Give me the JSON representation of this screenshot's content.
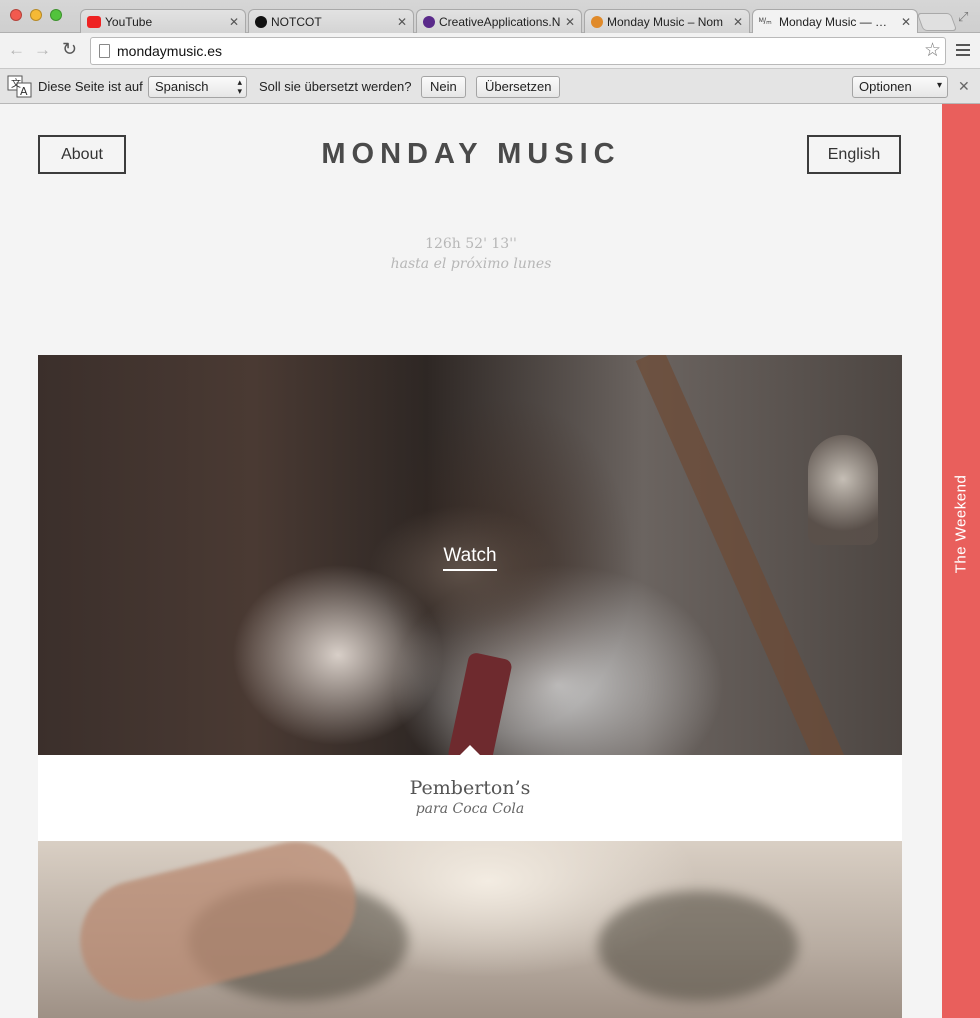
{
  "browser": {
    "tabs": [
      {
        "label": "YouTube",
        "icon": "youtube-icon",
        "active": false
      },
      {
        "label": "NOTCOT",
        "icon": "notcot-icon",
        "active": false
      },
      {
        "label": "CreativeApplications.N",
        "icon": "creativeapplications-icon",
        "active": false
      },
      {
        "label": "Monday Music – Nom",
        "icon": "monday-music-fav-icon",
        "active": false
      },
      {
        "label": "Monday Music — Mon",
        "icon": "mm-icon",
        "active": true
      }
    ],
    "url": "mondaymusic.es"
  },
  "translate_bar": {
    "prefix": "Diese Seite ist auf",
    "language": "Spanisch",
    "question": "Soll sie übersetzt werden?",
    "no_label": "Nein",
    "translate_label": "Übersetzen",
    "options_label": "Optionen"
  },
  "site": {
    "about_label": "About",
    "logo": "MONDAY MUSIC",
    "language_label": "English",
    "countdown": "126h 52' 13''",
    "countdown_sub": "hasta el próximo lunes",
    "side_tab_label": "The Weekend",
    "side_tab_color": "#e95f5c",
    "feature": {
      "watch_label": "Watch",
      "title": "Pemberton’s",
      "subtitle": "para Coca Cola"
    }
  }
}
